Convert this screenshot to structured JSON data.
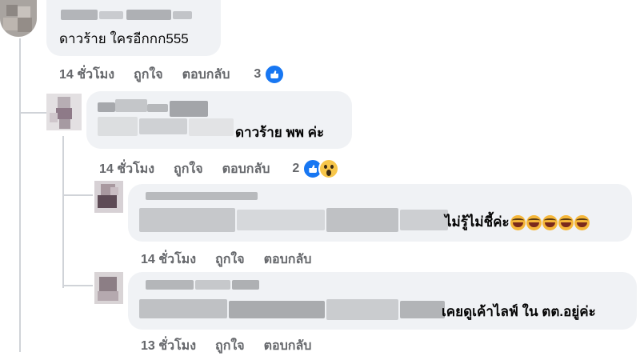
{
  "comments": [
    {
      "text": "ดาวร้าย ใครอีกกก555",
      "time": "14 ชั่วโมง",
      "like_label": "ถูกใจ",
      "reply_label": "ตอบกลับ",
      "reaction_count": "3",
      "reactions": [
        "like-icon"
      ]
    },
    {
      "text": "ดาวร้าย พพ ค่ะ",
      "time": "14 ชั่วโมง",
      "like_label": "ถูกใจ",
      "reply_label": "ตอบกลับ",
      "reaction_count": "2",
      "reactions": [
        "like-icon",
        "wow-icon"
      ]
    },
    {
      "text": "ไม่รู้ไม่ชี้ค่ะ",
      "time": "14 ชั่วโมง",
      "like_label": "ถูกใจ",
      "reply_label": "ตอบกลับ",
      "emojis": [
        "laughing-emoji",
        "laughing-emoji",
        "laughing-emoji",
        "laughing-emoji",
        "laughing-emoji"
      ]
    },
    {
      "text": "เคยดูเค้าไลฟ์ ใน ตต.อยู่ค่ะ",
      "time": "13 ชั่วโมง",
      "like_label": "ถูกใจ",
      "reply_label": "ตอบกลับ"
    }
  ],
  "colors": {
    "bubble": "#f0f2f5",
    "meta_text": "#65676b",
    "like_blue": "#1877f2",
    "thread_line": "#d0d3d8"
  }
}
